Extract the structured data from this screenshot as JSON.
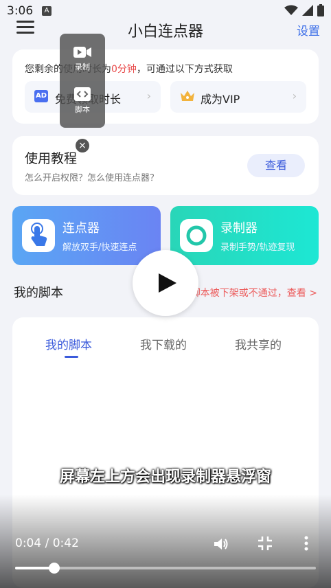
{
  "status_bar": {
    "time": "3:06",
    "notif_letter": "A"
  },
  "header": {
    "title": "小白连点器",
    "settings": "设置"
  },
  "time_card": {
    "prefix": "您剩余的使用时长为",
    "remaining": "0分钟",
    "suffix": "，可通过以下方式获取",
    "ad_badge": "AD",
    "ad_option": "免费领取时长",
    "vip_option": "成为VIP"
  },
  "tutorial": {
    "title": "使用教程",
    "subtitle": "怎么开启权限？怎么使用连点器？",
    "view_button": "查看"
  },
  "clicker": {
    "title": "连点器",
    "subtitle": "解放双手/快速连点"
  },
  "recorder": {
    "title": "录制器",
    "subtitle": "录制手势/轨迹复现"
  },
  "scripts": {
    "header": "我的脚本",
    "note": "有脚本被下架或不通过，查看 >",
    "tabs": [
      "我的脚本",
      "我下载的",
      "我共享的"
    ],
    "active_tab": "我的脚本"
  },
  "floating_panel": {
    "record": "录制",
    "script": "脚本"
  },
  "video": {
    "subtitle": "屏幕左上方会出现录制器悬浮窗",
    "time": "0:04 / 0:42",
    "progress": 0.13
  },
  "colors": {
    "accent": "#3b5bdb",
    "warning": "#e84a4a"
  }
}
